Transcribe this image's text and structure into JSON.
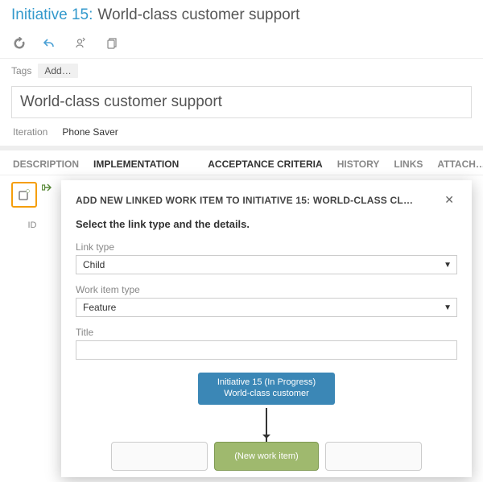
{
  "header": {
    "wid_label": "Initiative 15:",
    "title": "World-class customer support"
  },
  "tags": {
    "label": "Tags",
    "add": "Add…"
  },
  "title_field": "World-class customer support",
  "iteration": {
    "label": "Iteration",
    "value": "Phone Saver"
  },
  "tabs": {
    "description": "DESCRIPTION",
    "implementation": "IMPLEMENTATION",
    "acceptance": "ACCEPTANCE CRITERIA",
    "history": "HISTORY",
    "links": "LINKS",
    "attach": "ATTACH…"
  },
  "left": {
    "id_label": "ID"
  },
  "dialog": {
    "title": "ADD NEW LINKED WORK ITEM TO INITIATIVE 15: WORLD-CLASS CL…",
    "subtitle": "Select the link type and the details.",
    "link_type_label": "Link type",
    "link_type_value": "Child",
    "work_item_type_label": "Work item type",
    "work_item_type_value": "Feature",
    "title_label": "Title",
    "title_value": ""
  },
  "diagram": {
    "parent_line1": "Initiative 15 (In Progress)",
    "parent_line2": "World-class customer",
    "new_item": "(New work item)"
  }
}
